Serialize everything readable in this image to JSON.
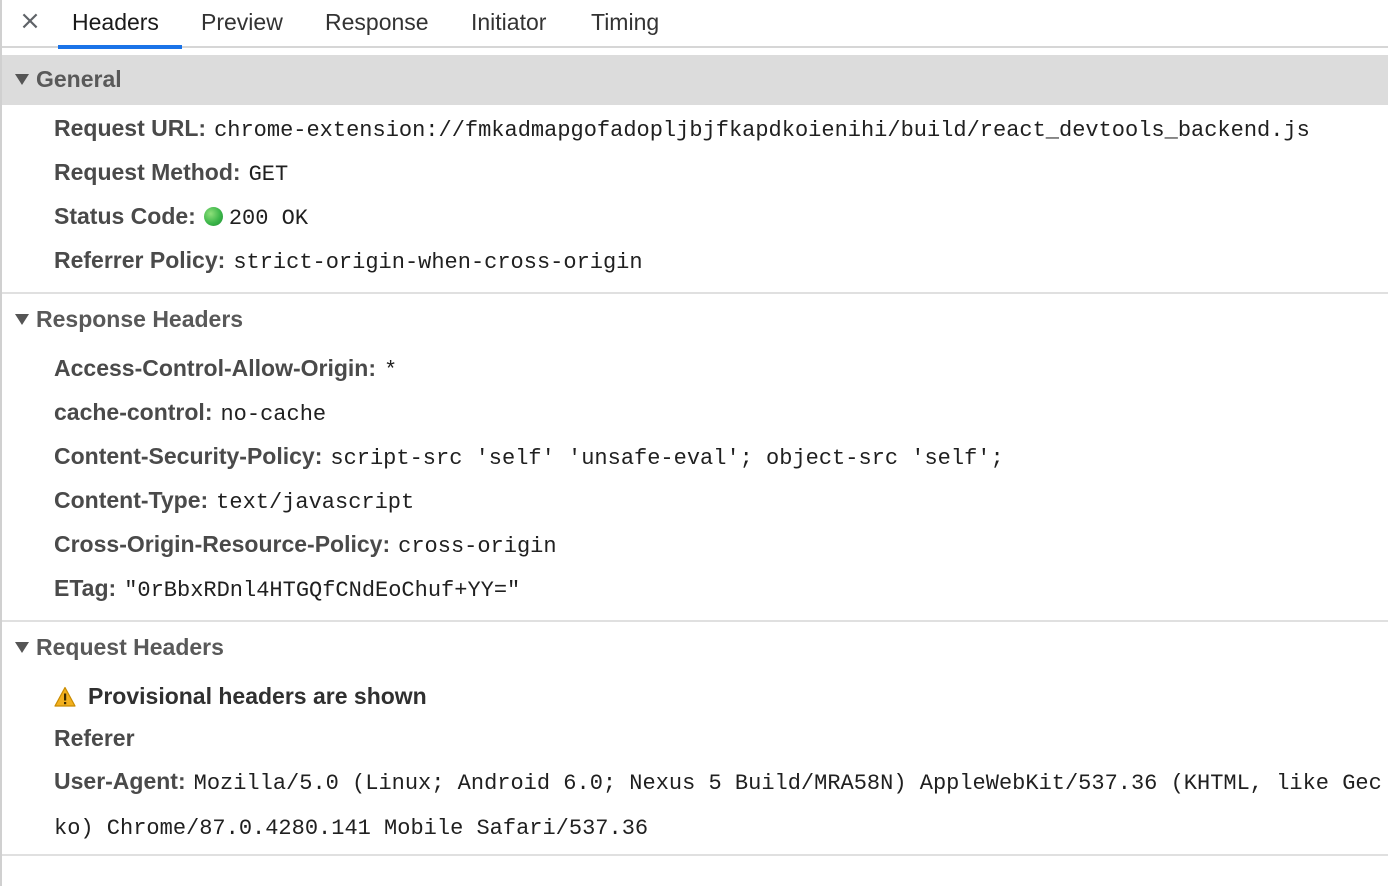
{
  "tabs": {
    "close_label": "×",
    "items": [
      {
        "label": "Headers",
        "active": true
      },
      {
        "label": "Preview",
        "active": false
      },
      {
        "label": "Response",
        "active": false
      },
      {
        "label": "Initiator",
        "active": false
      },
      {
        "label": "Timing",
        "active": false
      }
    ]
  },
  "general": {
    "title": "General",
    "rows": [
      {
        "key": "Request URL:",
        "value": "chrome-extension://fmkadmapgofadopljbjfkapdkoienihi/build/react_devtools_backend.js"
      },
      {
        "key": "Request Method:",
        "value": "GET"
      },
      {
        "key": "Status Code:",
        "value": "200 OK",
        "status_color": "#3cb64a"
      },
      {
        "key": "Referrer Policy:",
        "value": "strict-origin-when-cross-origin"
      }
    ]
  },
  "response_headers": {
    "title": "Response Headers",
    "rows": [
      {
        "key": "Access-Control-Allow-Origin:",
        "value": "*"
      },
      {
        "key": "cache-control:",
        "value": "no-cache"
      },
      {
        "key": "Content-Security-Policy:",
        "value": "script-src 'self' 'unsafe-eval'; object-src 'self';"
      },
      {
        "key": "Content-Type:",
        "value": "text/javascript"
      },
      {
        "key": "Cross-Origin-Resource-Policy:",
        "value": "cross-origin"
      },
      {
        "key": "ETag:",
        "value": "\"0rBbxRDnl4HTGQfCNdEoChuf+YY=\""
      }
    ]
  },
  "request_headers": {
    "title": "Request Headers",
    "warning": "Provisional headers are shown",
    "warning_icon": "warning-icon",
    "rows": [
      {
        "key": "Referer",
        "value": ""
      },
      {
        "key": "User-Agent:",
        "value": "Mozilla/5.0 (Linux; Android 6.0; Nexus 5 Build/MRA58N) AppleWebKit/537.36 (KHTML, like Gecko) Chrome/87.0.4280.141 Mobile Safari/537.36"
      }
    ]
  },
  "colors": {
    "accent": "#1a73e8",
    "selected_header_bg": "#dcdcdc",
    "status_ok": "#3cb64a",
    "warning": "#f2b01e"
  }
}
